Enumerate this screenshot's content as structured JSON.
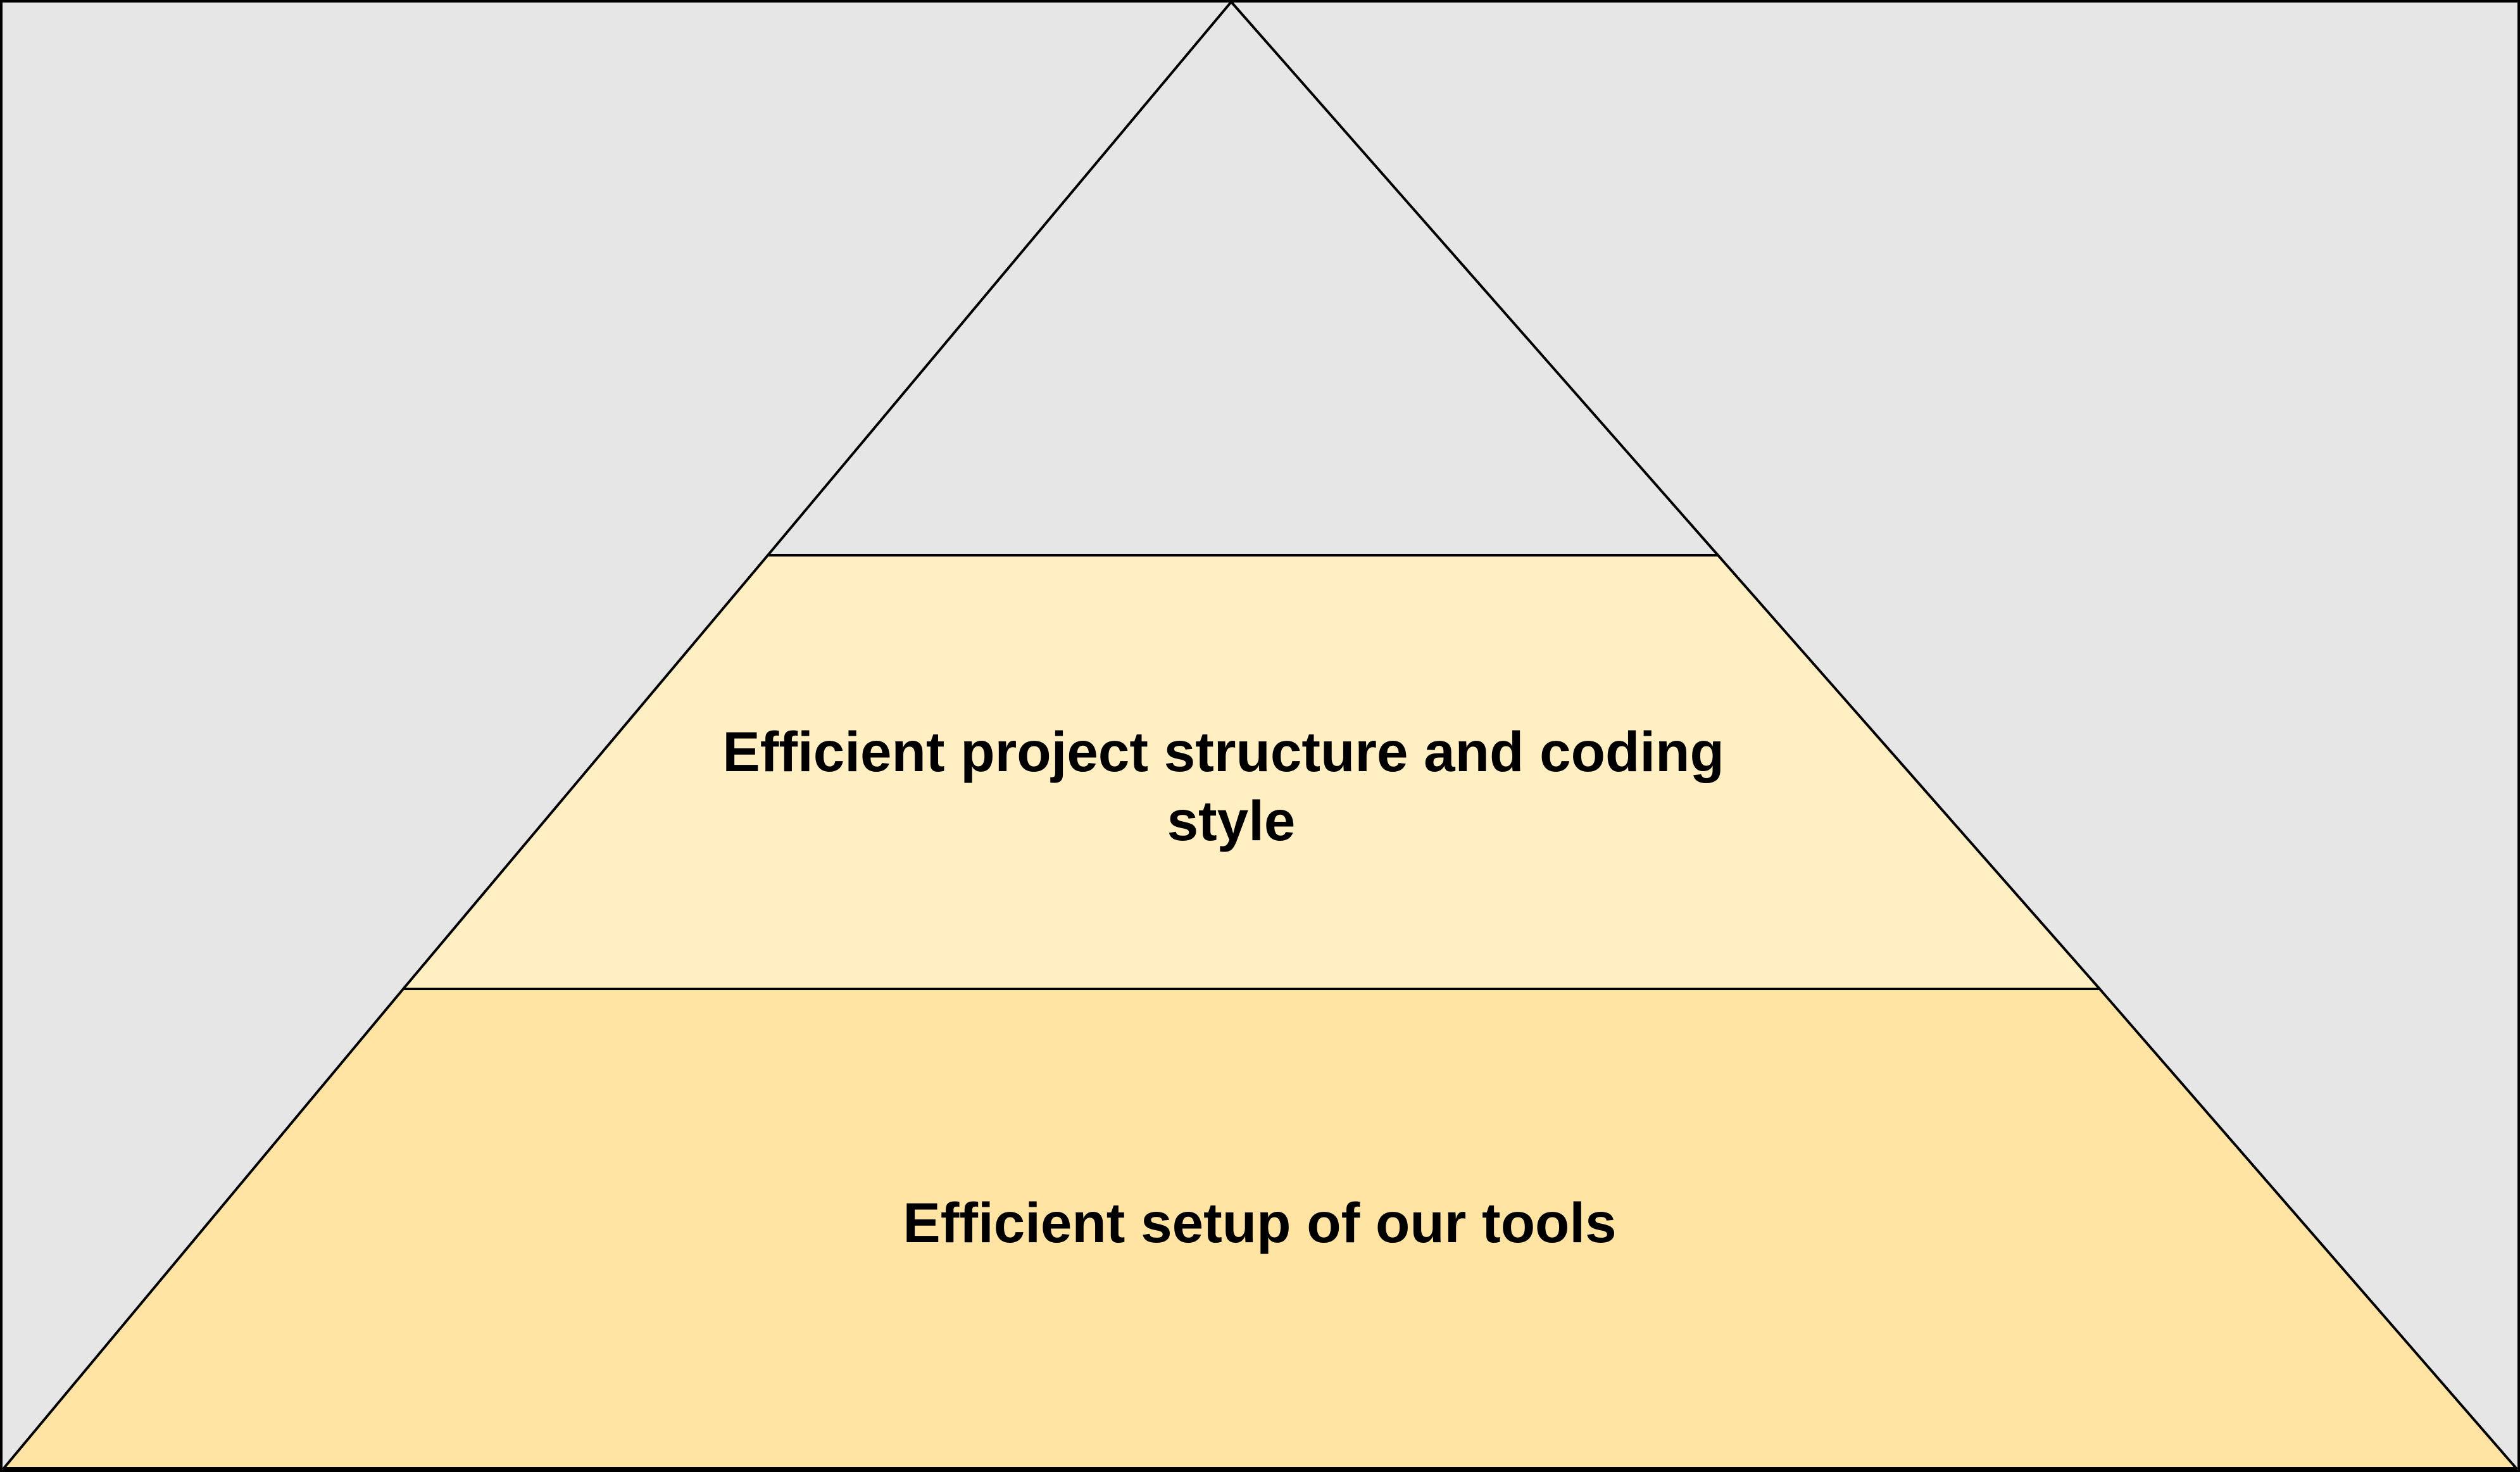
{
  "colors": {
    "background": "#e6e6e6",
    "top_tier": "#e6e6e6",
    "middle_tier": "#ffefc2",
    "bottom_tier": "#ffe4a3",
    "outline": "#000000"
  },
  "pyramid": {
    "tiers": [
      {
        "id": "top",
        "label_lines": []
      },
      {
        "id": "middle",
        "label_lines": [
          "Efficient project structure and coding",
          "style"
        ]
      },
      {
        "id": "bottom",
        "label_lines": [
          "Efficient setup of our tools"
        ]
      }
    ]
  }
}
